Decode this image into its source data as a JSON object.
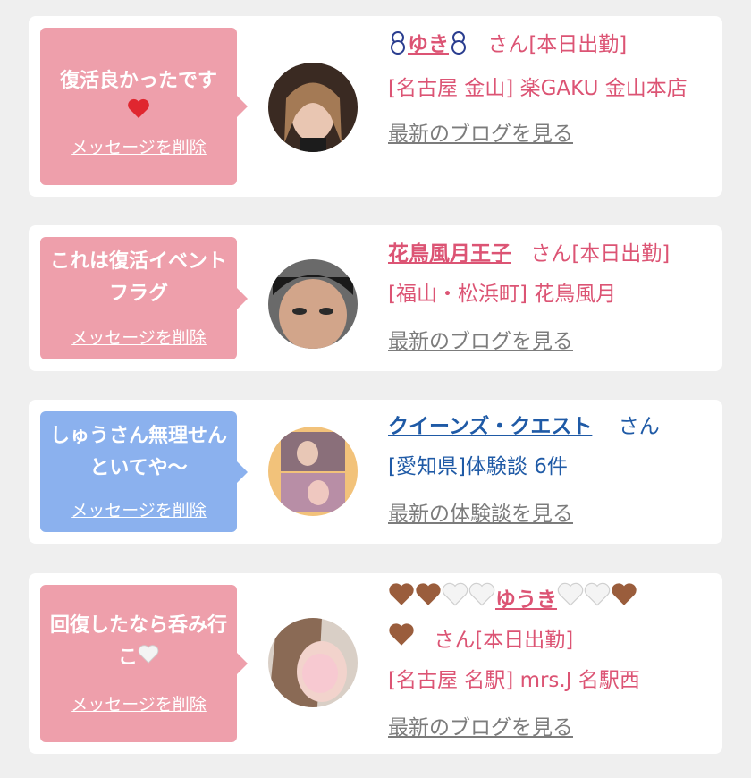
{
  "cards": [
    {
      "message": "復活良かったです",
      "delete_label": "メッセージを削除",
      "name": "ゆき",
      "honorific": "さん[本日出勤]",
      "shop": "[名古屋 金山] 楽GAKU 金山本店",
      "link": "最新のブログを見る"
    },
    {
      "message": "これは復活イベントフラグ",
      "delete_label": "メッセージを削除",
      "name": "花鳥風月王子",
      "honorific": "さん[本日出勤]",
      "shop": "[福山・松浜町] 花鳥風月",
      "link": "最新のブログを見る"
    },
    {
      "message": "しゅうさん無理せんといてや〜",
      "delete_label": "メッセージを削除",
      "name": "クイーンズ・クエスト",
      "honorific": "さん",
      "shop": "[愛知県]体験談 6件",
      "link": "最新の体験談を見る"
    },
    {
      "message": "回復したなら呑み行こ",
      "delete_label": "メッセージを削除",
      "name": "ゆうき",
      "honorific": "さん[本日出勤]",
      "shop": "[名古屋 名駅] mrs.J 名駅西",
      "link": "最新のブログを見る"
    }
  ],
  "colors": {
    "background": "#efefef",
    "card": "#ffffff",
    "bubble_pink": "#ee9fab",
    "bubble_blue": "#8bb1ee",
    "text_pink": "#dc5474",
    "text_blue": "#1f5aa6",
    "link_gray": "#7c7c7c"
  },
  "icons": [
    "snowman-icon",
    "red-heart-icon",
    "brown-heart-icon",
    "white-heart-icon"
  ]
}
